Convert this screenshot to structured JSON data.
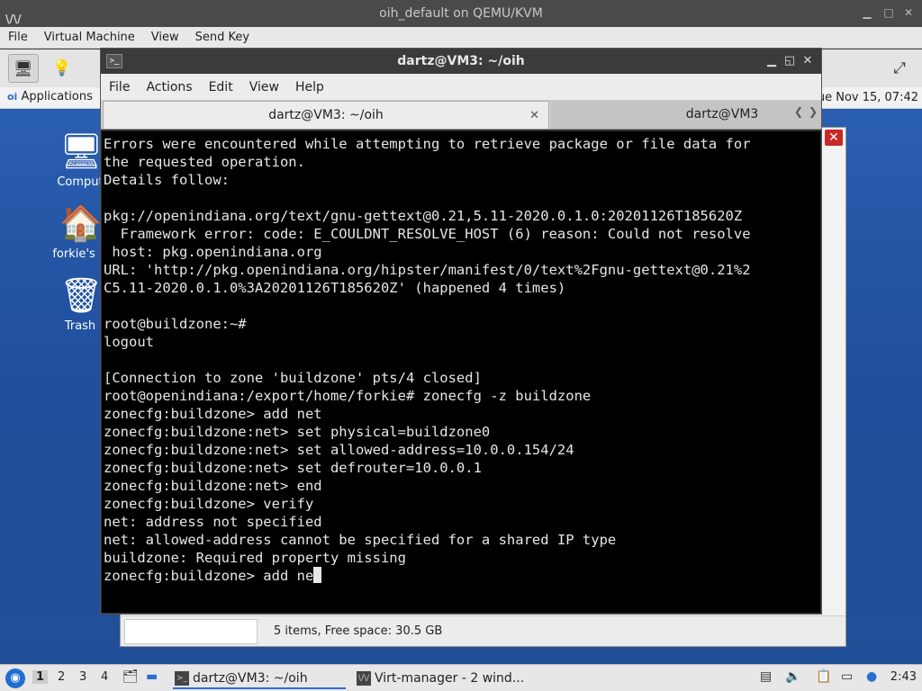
{
  "host": {
    "title": "oih_default on QEMU/KVM",
    "menu": [
      "File",
      "Virtual Machine",
      "View",
      "Send Key"
    ]
  },
  "guest_panel": {
    "applications_label": "Applications",
    "clock_top": "ue Nov 15, 07:42"
  },
  "desktop_icons": [
    {
      "label": "Comput",
      "icon": "computer-icon"
    },
    {
      "label": "forkie's H",
      "icon": "home-folder-icon"
    },
    {
      "label": "Trash",
      "icon": "trash-icon"
    }
  ],
  "file_manager": {
    "status_text": "5 items, Free space: 30.5 GB"
  },
  "terminal": {
    "title": "dartz@VM3: ~/oih",
    "menu": [
      "File",
      "Actions",
      "Edit",
      "View",
      "Help"
    ],
    "tabs": [
      {
        "label": "dartz@VM3: ~/oih",
        "active": true
      },
      {
        "label": "dartz@VM3",
        "active": false
      }
    ],
    "lines": [
      "Errors were encountered while attempting to retrieve package or file data for",
      "the requested operation.",
      "Details follow:",
      "",
      "pkg://openindiana.org/text/gnu-gettext@0.21,5.11-2020.0.1.0:20201126T185620Z",
      "  Framework error: code: E_COULDNT_RESOLVE_HOST (6) reason: Could not resolve",
      " host: pkg.openindiana.org",
      "URL: 'http://pkg.openindiana.org/hipster/manifest/0/text%2Fgnu-gettext@0.21%2",
      "C5.11-2020.0.1.0%3A20201126T185620Z' (happened 4 times)",
      "",
      "root@buildzone:~#",
      "logout",
      "",
      "[Connection to zone 'buildzone' pts/4 closed]",
      "root@openindiana:/export/home/forkie# zonecfg -z buildzone",
      "zonecfg:buildzone> add net",
      "zonecfg:buildzone:net> set physical=buildzone0",
      "zonecfg:buildzone:net> set allowed-address=10.0.0.154/24",
      "zonecfg:buildzone:net> set defrouter=10.0.0.1",
      "zonecfg:buildzone:net> end",
      "zonecfg:buildzone> verify",
      "net: address not specified",
      "net: allowed-address cannot be specified for a shared IP type",
      "buildzone: Required property missing"
    ],
    "prompt_line": "zonecfg:buildzone> add ne"
  },
  "taskbar": {
    "workspaces": [
      "1",
      "2",
      "3",
      "4"
    ],
    "tasks": [
      {
        "label": "dartz@VM3: ~/oih",
        "active": true
      },
      {
        "label": "Virt-manager - 2 wind...",
        "active": false
      }
    ],
    "clock": "2:43"
  }
}
